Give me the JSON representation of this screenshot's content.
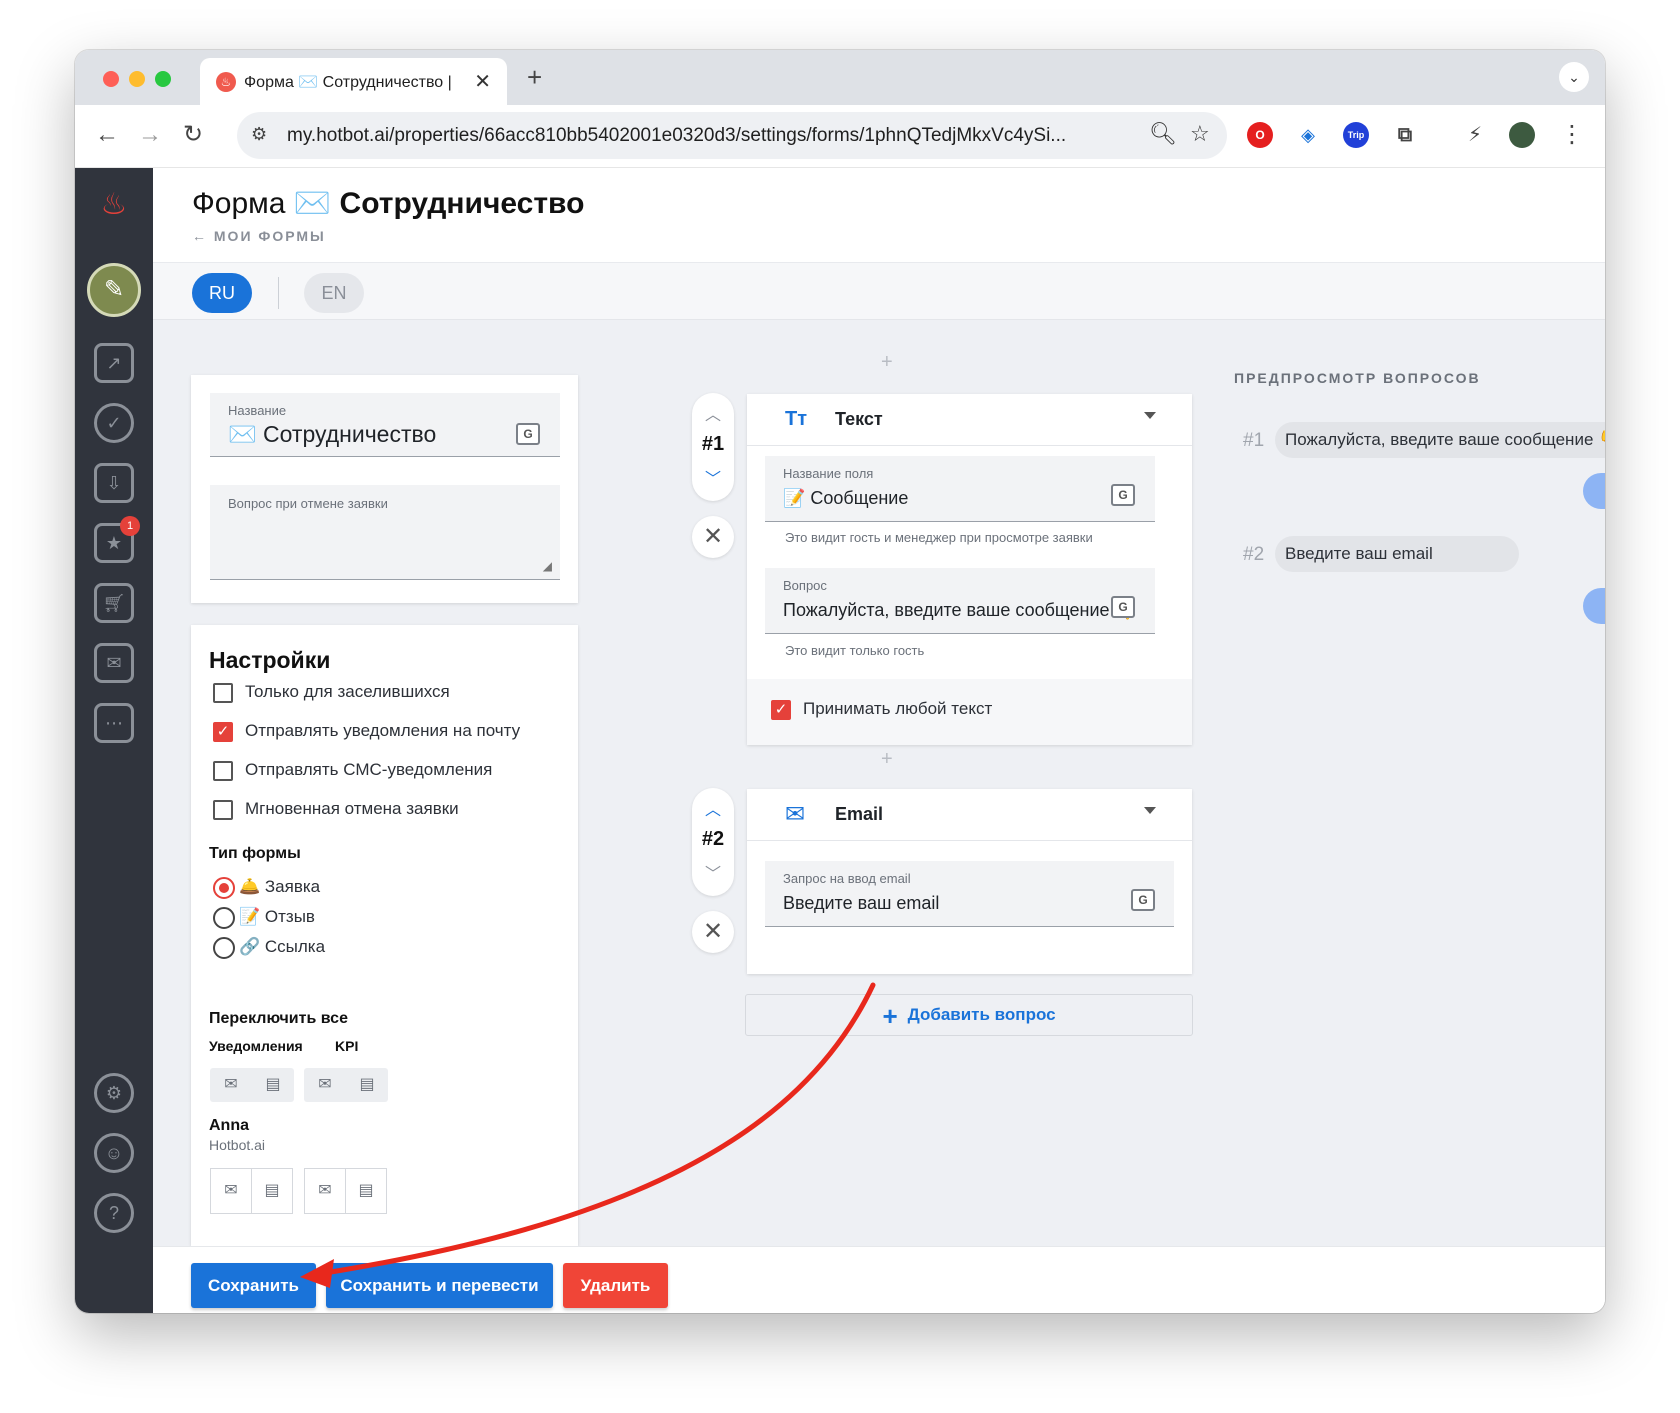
{
  "browser": {
    "tab_title": "Форма ✉️ Сотрудничество |",
    "tab_close": "✕",
    "new_tab": "+",
    "tab_menu": "⌄",
    "url": "my.hotbot.ai/properties/66acc810bb5402001e0320d3/settings/forms/1phnQTedjMkxVc4ySi...",
    "ext_trip_label": "Trip"
  },
  "sidebar": {
    "notification_badge": "1"
  },
  "header": {
    "title_prefix": "Форма ✉️",
    "title_name": "Сотрудничество",
    "back_link": "← МОИ ФОРМЫ"
  },
  "languages": {
    "active": "RU",
    "inactive": "EN"
  },
  "form_card": {
    "name_label": "Название",
    "name_value": "✉️ Сотрудничество",
    "cancel_question_label": "Вопрос при отмене заявки",
    "cancel_question_value": ""
  },
  "settings": {
    "title": "Настройки",
    "checkboxes": [
      {
        "label": "Только для заселившихся",
        "checked": false
      },
      {
        "label": "Отправлять уведомления на почту",
        "checked": true
      },
      {
        "label": "Отправлять СМС-уведомления",
        "checked": false
      },
      {
        "label": "Мгновенная отмена заявки",
        "checked": false
      }
    ],
    "form_type_title": "Тип формы",
    "form_types": [
      {
        "label": "🛎️ Заявка",
        "selected": true
      },
      {
        "label": "📝 Отзыв",
        "selected": false
      },
      {
        "label": "🔗 Ссылка",
        "selected": false
      }
    ],
    "toggle_all_title": "Переключить все",
    "notifications_label": "Уведомления",
    "kpi_label": "KPI",
    "user_name": "Anna",
    "user_org": "Hotbot.ai",
    "mail_icon": "✉",
    "chat_icon": "▤"
  },
  "questions": [
    {
      "number": "#1",
      "type_icon": "Tт",
      "type_label": "Текст",
      "field_name_label": "Название поля",
      "field_name_value": "📝 Сообщение",
      "field_name_hint": "Это видит гость и менеджер при просмотре заявки",
      "question_label": "Вопрос",
      "question_value": "Пожалуйста, введите ваше сообщение 👇",
      "question_hint": "Это видит только гость",
      "accept_any_label": "Принимать любой текст",
      "accept_any_checked": true
    },
    {
      "number": "#2",
      "type_icon": "✉",
      "type_label": "Email",
      "prompt_label": "Запрос на ввод email",
      "prompt_value": "Введите ваш email"
    }
  ],
  "add_question_label": "Добавить вопрос",
  "add_question_icon": "+",
  "separator_plus": "+",
  "delete_icon": "✕",
  "preview": {
    "title": "ПРЕДПРОСМОТР ВОПРОСОВ",
    "items": [
      {
        "number": "#1",
        "text": "Пожалуйста, введите ваше сообщение 👇"
      },
      {
        "number": "#2",
        "text": "Введите ваш email"
      }
    ],
    "more_label": "⋯"
  },
  "footer": {
    "save": "Сохранить",
    "save_translate": "Сохранить и перевести",
    "delete": "Удалить"
  },
  "colors": {
    "primary": "#1a73d9",
    "danger": "#f04537",
    "annotation_arrow": "#e8281c"
  }
}
